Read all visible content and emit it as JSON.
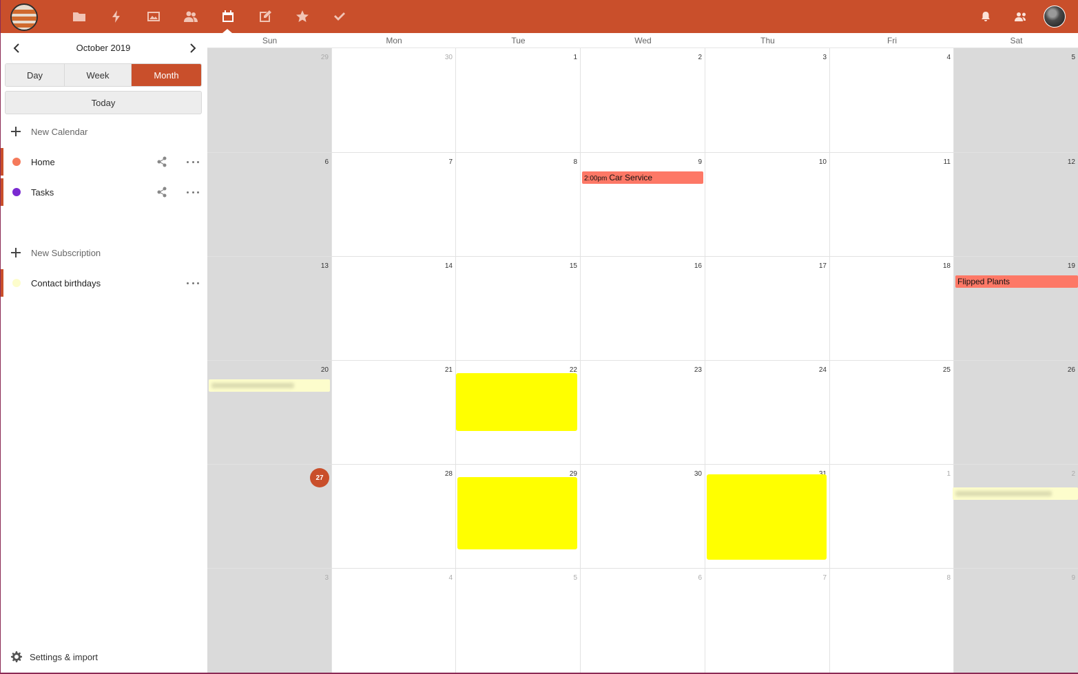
{
  "header": {
    "nav_icons": [
      "files-icon",
      "activity-icon",
      "photos-icon",
      "contacts-icon",
      "calendar-icon",
      "notes-icon",
      "bookmarks-icon",
      "tasks-icon"
    ],
    "active_app": "calendar",
    "right_icons": [
      "notifications-icon",
      "contacts-menu-icon"
    ]
  },
  "sidebar": {
    "month_label": "October 2019",
    "views": {
      "day": "Day",
      "week": "Week",
      "month": "Month",
      "active": "month"
    },
    "today_label": "Today",
    "new_calendar_label": "New Calendar",
    "calendars": [
      {
        "name": "Home",
        "color": "#f57a5b"
      },
      {
        "name": "Tasks",
        "color": "#7a2ad1"
      }
    ],
    "new_subscription_label": "New Subscription",
    "subscriptions": [
      {
        "name": "Contact birthdays",
        "color": "#fdfdcc"
      }
    ],
    "settings_label": "Settings & import"
  },
  "calendar": {
    "weekdays": [
      "Sun",
      "Mon",
      "Tue",
      "Wed",
      "Thu",
      "Fri",
      "Sat"
    ],
    "weeks": [
      [
        "29",
        "30",
        "1",
        "2",
        "3",
        "4",
        "5"
      ],
      [
        "6",
        "7",
        "8",
        "9",
        "10",
        "11",
        "12"
      ],
      [
        "13",
        "14",
        "15",
        "16",
        "17",
        "18",
        "19"
      ],
      [
        "20",
        "21",
        "22",
        "23",
        "24",
        "25",
        "26"
      ],
      [
        "27",
        "28",
        "29",
        "30",
        "31",
        "1",
        "2"
      ],
      [
        "3",
        "4",
        "5",
        "6",
        "7",
        "8",
        "9"
      ]
    ],
    "today": "27",
    "events": {
      "car_service": {
        "time": "2:00pm",
        "title": "Car Service"
      },
      "flipped_plants": {
        "title": "Flipped Plants"
      }
    },
    "colors": {
      "accent": "#c94f2b",
      "event_home": "#fd7866",
      "birthday": "#fdfdcc",
      "weekend": "#dadada"
    }
  }
}
